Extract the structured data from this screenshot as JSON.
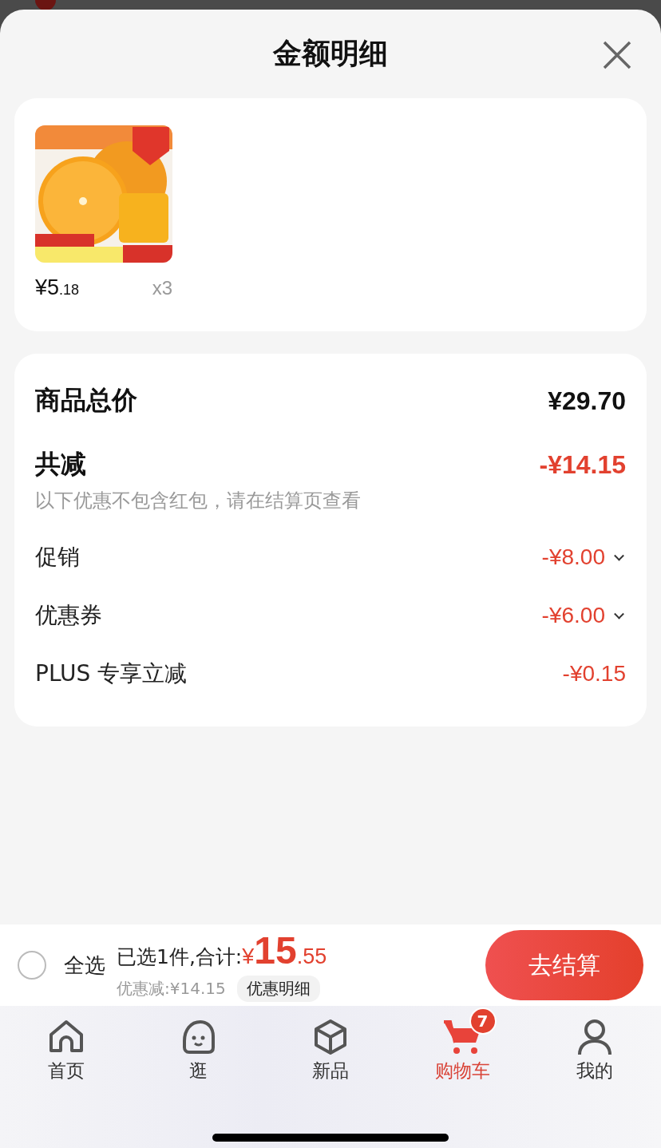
{
  "sheet": {
    "title": "金额明细"
  },
  "product": {
    "price_main": "¥5",
    "price_cents": ".18",
    "quantity": "x3"
  },
  "summary": {
    "total": {
      "label": "商品总价",
      "value": "¥29.70"
    },
    "reduction": {
      "label": "共减",
      "value": "-¥14.15",
      "note": "以下优惠不包含红包，请在结算页查看"
    },
    "items": [
      {
        "label": "促销",
        "value": "-¥8.00",
        "expandable": true
      },
      {
        "label": "优惠券",
        "value": "-¥6.00",
        "expandable": true
      },
      {
        "label": "PLUS 专享立减",
        "value": "-¥0.15",
        "expandable": false
      }
    ]
  },
  "checkout": {
    "select_all": {
      "label": "全选",
      "checked": false
    },
    "selected_text": "已选1件,合计:",
    "currency": "¥",
    "amount_main": "15",
    "amount_cents": ".55",
    "discount_text": "优惠减:¥14.15",
    "detail_button": "优惠明细",
    "button": "去结算"
  },
  "tabs": [
    {
      "label": "首页",
      "selected": false
    },
    {
      "label": "逛",
      "selected": false
    },
    {
      "label": "新品",
      "selected": false
    },
    {
      "label": "购物车",
      "selected": true,
      "badge": "7"
    },
    {
      "label": "我的",
      "selected": false
    }
  ]
}
